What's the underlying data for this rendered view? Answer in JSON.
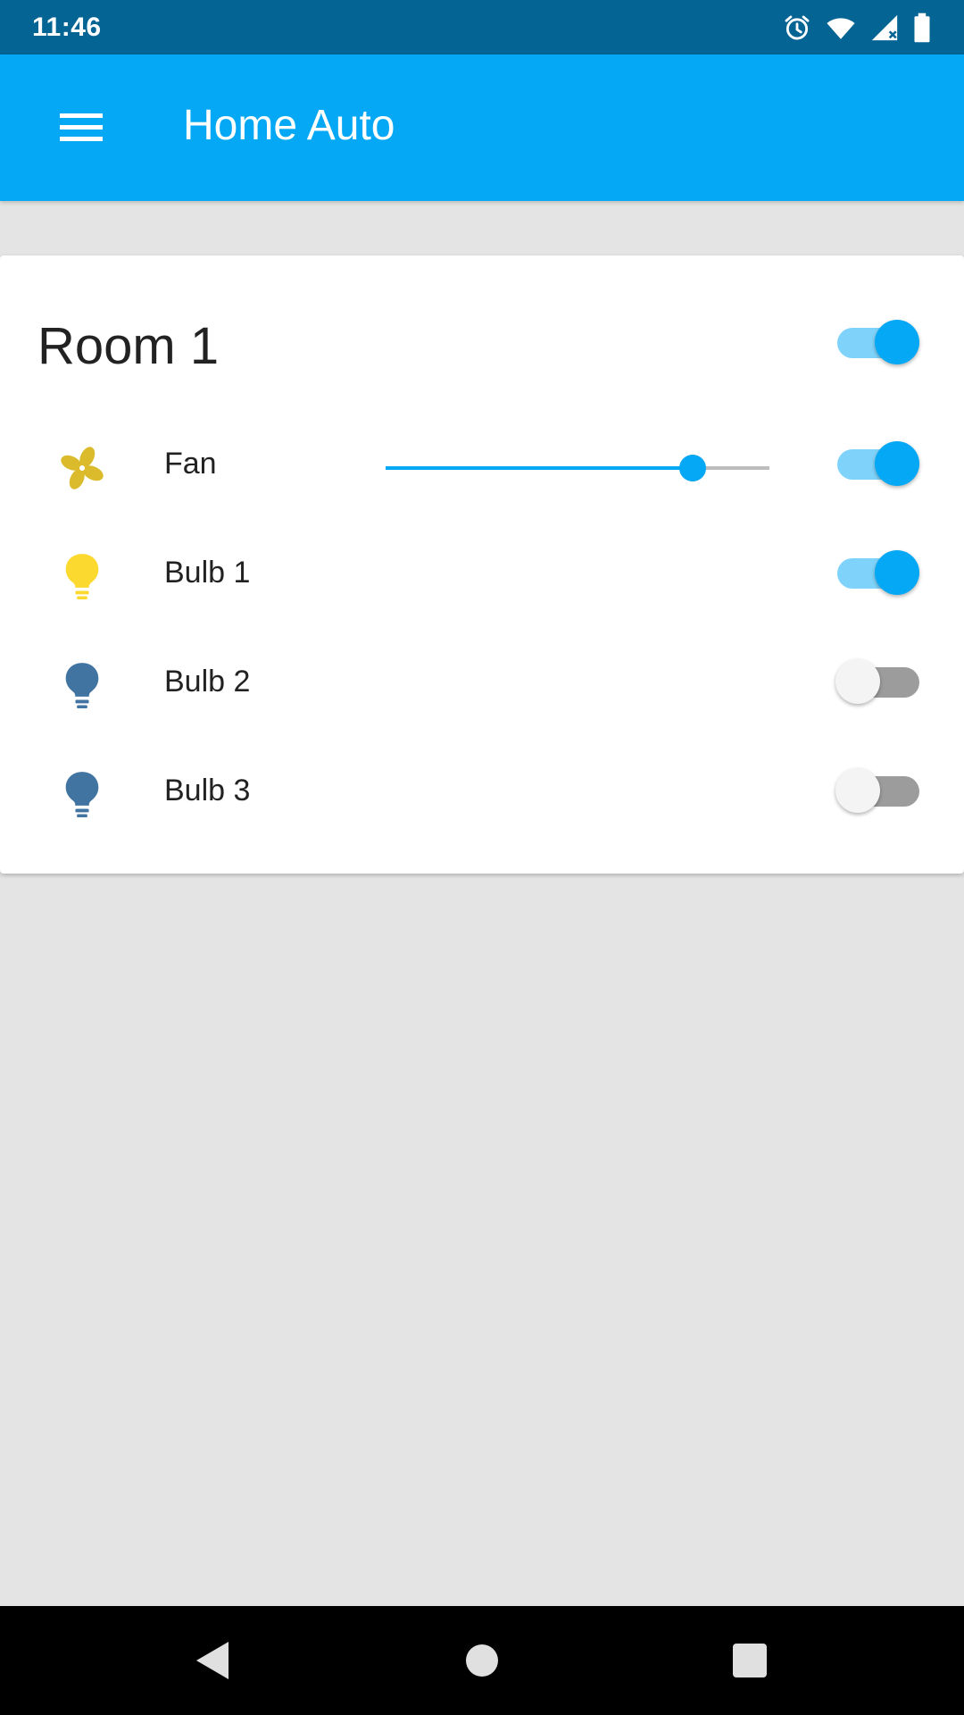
{
  "status_bar": {
    "time": "11:46",
    "icons": [
      "alarm-icon",
      "wifi-icon",
      "signal-icon",
      "battery-icon"
    ]
  },
  "app_bar": {
    "title": "Home Auto",
    "menu_icon": "menu-icon",
    "color": "#04a8f4"
  },
  "room": {
    "title": "Room 1",
    "switch_on": true,
    "devices": [
      {
        "label": "Fan",
        "icon": "fan-icon",
        "icon_color": "#dbbb2c",
        "on": true,
        "speed": 0.8
      },
      {
        "label": "Bulb 1",
        "icon": "bulb-icon",
        "icon_color": "#fcd92f",
        "on": true
      },
      {
        "label": "Bulb 2",
        "icon": "bulb-icon",
        "icon_color": "#4274a2",
        "on": false
      },
      {
        "label": "Bulb 3",
        "icon": "bulb-icon",
        "icon_color": "#4274a2",
        "on": false
      }
    ]
  },
  "colors": {
    "status_bar": "#046494",
    "accent": "#04a8f4",
    "background": "#e4e4e4"
  },
  "nav_bar": {
    "buttons": [
      "back-icon",
      "home-icon",
      "recents-icon"
    ]
  }
}
